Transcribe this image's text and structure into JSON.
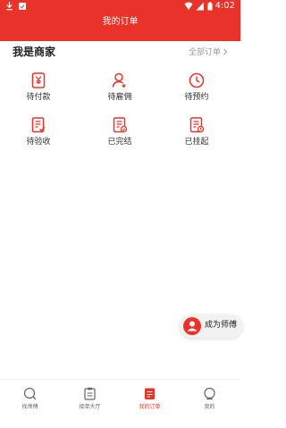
{
  "status": {
    "time": "4:02"
  },
  "header": {
    "title": "我的订单"
  },
  "section": {
    "title": "我是商家",
    "all_orders": "全部订单"
  },
  "orders": [
    {
      "label": "待付款",
      "icon": "payment-icon"
    },
    {
      "label": "待雇佣",
      "icon": "hire-icon"
    },
    {
      "label": "待预约",
      "icon": "clock-icon"
    },
    {
      "label": "待验收",
      "icon": "acceptance-icon"
    },
    {
      "label": "已完结",
      "icon": "completed-icon"
    },
    {
      "label": "已挂起",
      "icon": "suspended-icon"
    }
  ],
  "fab": {
    "label": "成为师傅"
  },
  "tabs": [
    {
      "label": "找师傅",
      "icon": "search-icon",
      "active": false
    },
    {
      "label": "接单大厅",
      "icon": "clipboard-icon",
      "active": false
    },
    {
      "label": "我的订单",
      "icon": "order-icon",
      "active": true
    },
    {
      "label": "我的",
      "icon": "profile-icon",
      "active": false
    }
  ],
  "colors": {
    "accent": "#e8322a",
    "muted": "#9a9a9a"
  }
}
